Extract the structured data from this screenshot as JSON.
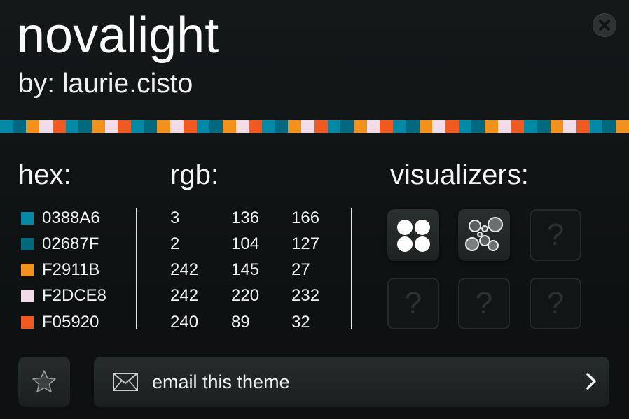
{
  "header": {
    "title": "novalight",
    "byline": "by: laurie.cisto",
    "close_icon": "close-icon"
  },
  "stripe_colors": [
    "#0388A6",
    "#02687F",
    "#F2911B",
    "#F2DCE8",
    "#F05920"
  ],
  "sections": {
    "hex_heading": "hex:",
    "rgb_heading": "rgb:",
    "visualizers_heading": "visualizers:"
  },
  "colors": [
    {
      "hex": "0388A6",
      "swatch": "#0388A6",
      "r": "3",
      "g": "136",
      "b": "166"
    },
    {
      "hex": "02687F",
      "swatch": "#02687F",
      "r": "2",
      "g": "104",
      "b": "127"
    },
    {
      "hex": "F2911B",
      "swatch": "#F2911B",
      "r": "242",
      "g": "145",
      "b": "27"
    },
    {
      "hex": "F2DCE8",
      "swatch": "#F2DCE8",
      "r": "242",
      "g": "220",
      "b": "232"
    },
    {
      "hex": "F05920",
      "swatch": "#F05920",
      "r": "240",
      "g": "89",
      "b": "32"
    }
  ],
  "visualizers": [
    {
      "name": "dots-visualizer",
      "icon": "four-dots-icon",
      "state": "active"
    },
    {
      "name": "bubbles-visualizer",
      "icon": "bubbles-icon",
      "state": "active"
    },
    {
      "name": "locked-visualizer",
      "icon": "question-mark-icon",
      "state": "locked",
      "glyph": "?"
    },
    {
      "name": "locked-visualizer",
      "icon": "question-mark-icon",
      "state": "locked",
      "glyph": "?"
    },
    {
      "name": "locked-visualizer",
      "icon": "question-mark-icon",
      "state": "locked",
      "glyph": "?"
    },
    {
      "name": "locked-visualizer",
      "icon": "question-mark-icon",
      "state": "locked",
      "glyph": "?"
    }
  ],
  "footer": {
    "favorite_icon": "star-icon",
    "email_icon": "envelope-icon",
    "email_label": "email this theme",
    "chevron_icon": "chevron-right-icon"
  }
}
